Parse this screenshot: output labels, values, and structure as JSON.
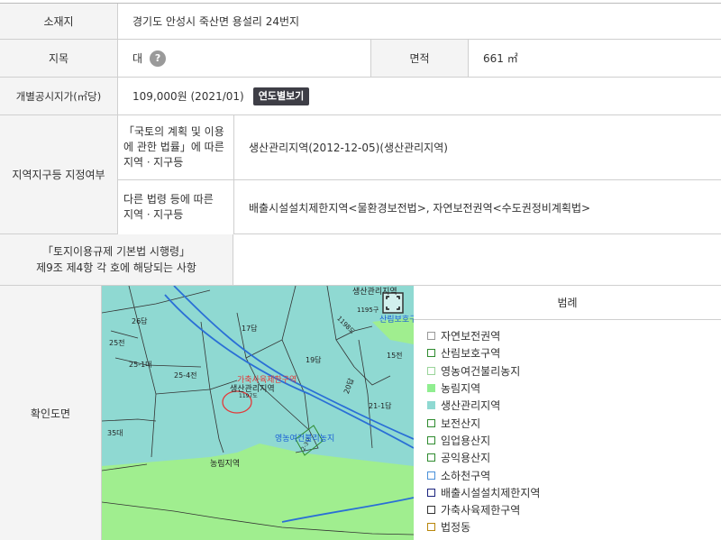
{
  "location": {
    "label": "소재지",
    "value": "경기도 안성시 죽산면 용설리 24번지"
  },
  "land_category": {
    "label": "지목",
    "value": "대",
    "help": "?"
  },
  "area": {
    "label": "면적",
    "value": "661 ㎡"
  },
  "price": {
    "label": "개별공시지가(㎡당)",
    "value": "109,000원 (2021/01)",
    "button": "연도별보기"
  },
  "zoning": {
    "label": "지역지구등 지정여부",
    "national": {
      "label_lines": [
        "「국토의 계획 및 이용",
        "에 관한 법률」에 따른",
        "지역ㆍ지구등"
      ],
      "value": "생산관리지역(2012-12-05)(생산관리지역)"
    },
    "other": {
      "label_lines": [
        "다른 법령 등에 따른",
        "지역ㆍ지구등"
      ],
      "value": "배출시설설치제한지역<물환경보전법>, 자연보전권역<수도권정비계획법>"
    }
  },
  "decree": {
    "label_lines": [
      "「토지이용규제 기본법 시행령」",
      "제9조 제4항 각 호에 해당되는 사항"
    ],
    "value": ""
  },
  "map_section": {
    "label": "확인도면",
    "expand_icon": "expand-icon"
  },
  "map_labels": {
    "parcels": [
      "26답",
      "17답",
      "25전",
      "25-1대",
      "25-4전",
      "19답",
      "15전",
      "20답",
      "21-1답",
      "35대",
      "1195구",
      "1198도",
      "1197도",
      "2-3구"
    ],
    "zones": [
      "생산관리지역",
      "산림보호구",
      "농림지역",
      "영농여건불리농지",
      "생산관리지역",
      "가축사육제한구역"
    ]
  },
  "legend": {
    "title": "범례",
    "items": [
      {
        "label": "자연보전권역",
        "border": "#999999",
        "fill": "#ffffff"
      },
      {
        "label": "산림보호구역",
        "border": "#2e8b2e",
        "fill": "#ffffff"
      },
      {
        "label": "영농여건불리농지",
        "border": "#9ad49a",
        "fill": "#ffffff"
      },
      {
        "label": "농림지역",
        "border": "#90ee90",
        "fill": "#90ee90"
      },
      {
        "label": "생산관리지역",
        "border": "#8fd9d2",
        "fill": "#8fd9d2"
      },
      {
        "label": "보전산지",
        "border": "#2e8b2e",
        "fill": "#ffffff"
      },
      {
        "label": "임업용산지",
        "border": "#2e8b2e",
        "fill": "#ffffff"
      },
      {
        "label": "공익용산지",
        "border": "#2e8b2e",
        "fill": "#ffffff"
      },
      {
        "label": "소하천구역",
        "border": "#4a90d9",
        "fill": "#ffffff"
      },
      {
        "label": "배출시설설치제한지역",
        "border": "#1a237e",
        "fill": "#ffffff"
      },
      {
        "label": "가축사육제한구역",
        "border": "#333333",
        "fill": "#ffffff"
      },
      {
        "label": "법정동",
        "border": "#b8860b",
        "fill": "#ffffff"
      }
    ]
  }
}
